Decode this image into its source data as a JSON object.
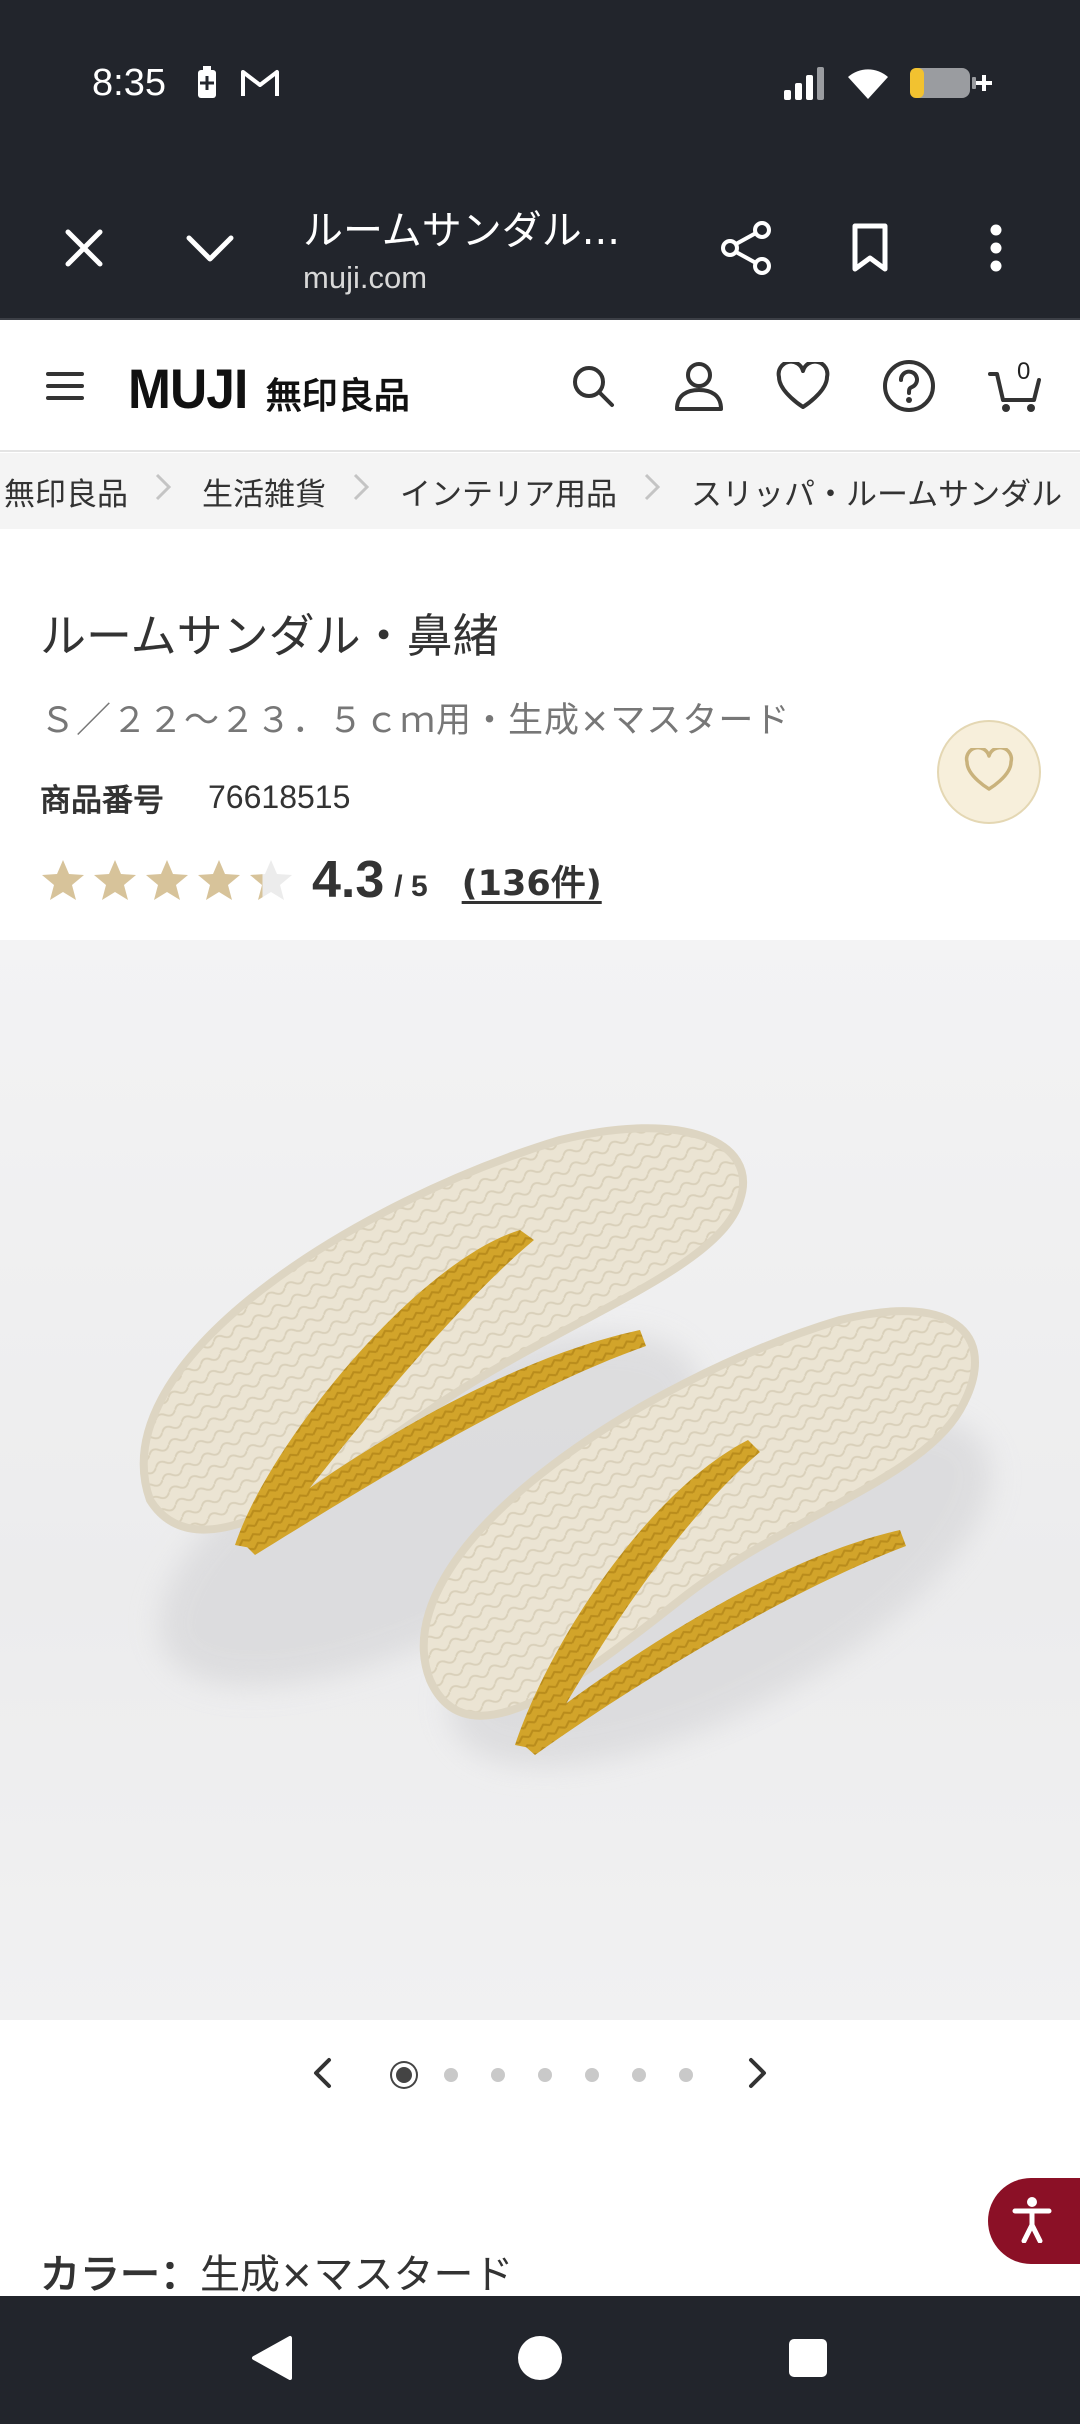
{
  "status_bar": {
    "time": "8:35",
    "icons_left": [
      "battery-saver-icon",
      "gmail-icon"
    ],
    "icons_right": [
      "signal-icon",
      "wifi-icon",
      "battery-charging-icon"
    ]
  },
  "browser": {
    "close_icon": "close-icon",
    "collapse_icon": "chevron-down-icon",
    "title": "ルームサンダル...",
    "url": "muji.com",
    "actions": [
      "share-icon",
      "bookmark-icon",
      "more-vert-icon"
    ]
  },
  "header": {
    "menu_icon": "menu-icon",
    "logo_en": "MUJI",
    "logo_ja": "無印良品",
    "icons": [
      "search-icon",
      "account-icon",
      "favorite-icon",
      "help-icon",
      "cart-icon"
    ],
    "cart_count": "0"
  },
  "breadcrumb": {
    "items": [
      "無印良品",
      "生活雑貨",
      "インテリア用品",
      "スリッパ・ルームサンダル"
    ],
    "separator": "›"
  },
  "product": {
    "title": "ルームサンダル・鼻緒",
    "variant": "Ｓ／２２～２３．５ｃｍ用・生成×マスタード",
    "sku_label": "商品番号",
    "sku": "76618515",
    "rating": "4.3",
    "rating_max": "/ 5",
    "rating_fraction": 0.86,
    "review_count": "(136件)",
    "favorite_icon": "heart-outline-icon"
  },
  "carousel": {
    "total": 7,
    "active_index": 0,
    "prev_icon": "chevron-left-icon",
    "next_icon": "chevron-right-icon"
  },
  "color": {
    "label": "カラー：",
    "value": "生成×マスタード"
  },
  "accessibility_icon": "accessibility-icon",
  "nav": [
    "back-icon",
    "home-icon",
    "recents-icon"
  ],
  "colors": {
    "system_bar": "#22252c",
    "star_gold": "#d7c39a",
    "accent_red": "#8b1026",
    "mustard": "#d4a62a",
    "jute": "#e9e2d0"
  }
}
